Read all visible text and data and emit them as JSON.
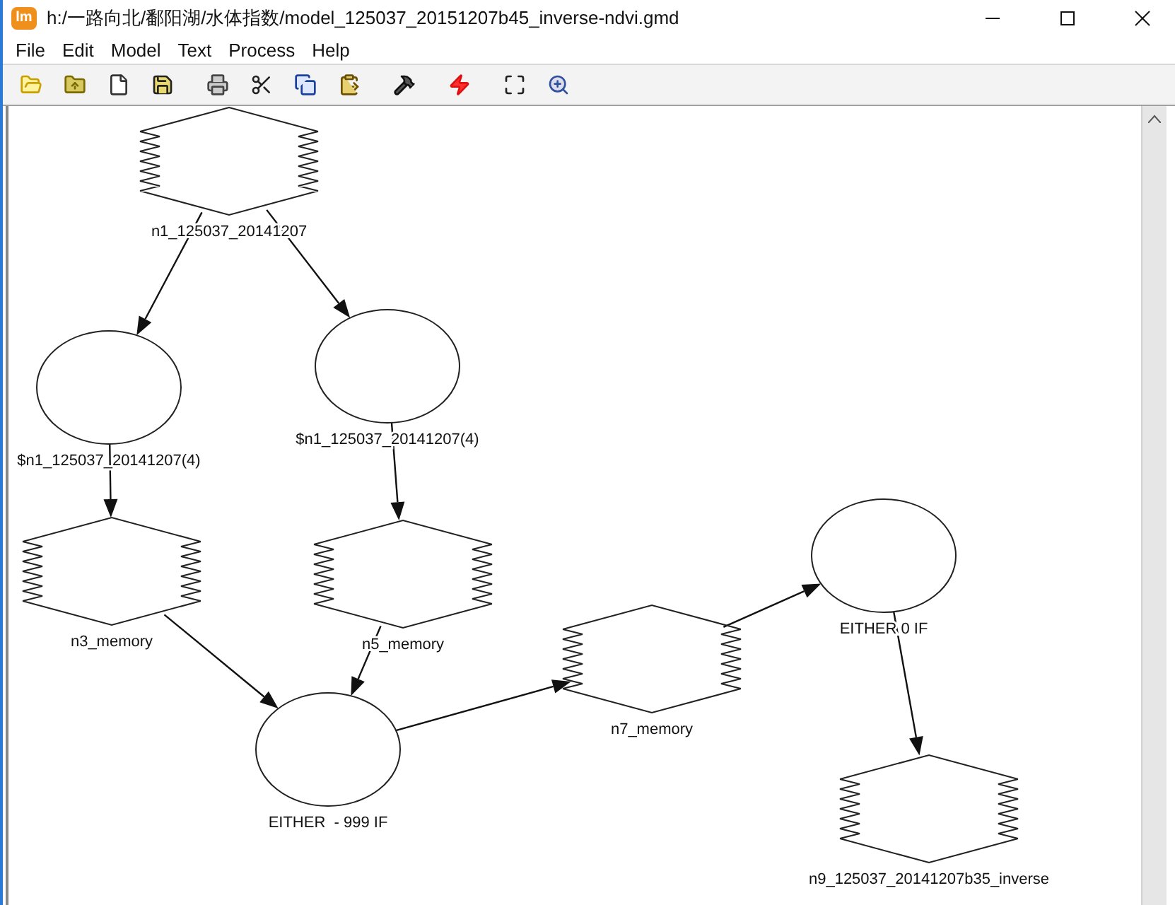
{
  "window": {
    "app_icon": "lm",
    "title": "h:/一路向北/鄱阳湖/水体指数/model_125037_20151207b45_inverse-ndvi.gmd"
  },
  "menu": [
    "File",
    "Edit",
    "Model",
    "Text",
    "Process",
    "Help"
  ],
  "toolbar": [
    {
      "kind": "open"
    },
    {
      "kind": "open-up"
    },
    {
      "kind": "new"
    },
    {
      "kind": "save"
    },
    {
      "kind": "print"
    },
    {
      "kind": "cut"
    },
    {
      "kind": "copy"
    },
    {
      "kind": "paste"
    },
    {
      "kind": "build"
    },
    {
      "kind": "run"
    },
    {
      "kind": "fit"
    },
    {
      "kind": "zoom"
    }
  ],
  "diagram": {
    "nodes": [
      {
        "kind": "raster",
        "label": "n1_125037_20141207"
      },
      {
        "kind": "function",
        "label": "$n1_125037_20141207(4)"
      },
      {
        "kind": "function",
        "label": "$n1_125037_20141207(4)"
      },
      {
        "kind": "raster",
        "label": "n3_memory"
      },
      {
        "kind": "raster",
        "label": "n5_memory"
      },
      {
        "kind": "function",
        "label": "EITHER  - 999 IF"
      },
      {
        "kind": "raster",
        "label": "n7_memory"
      },
      {
        "kind": "function",
        "label": "EITHER 0 IF"
      },
      {
        "kind": "raster",
        "label": "n9_125037_20141207b35_inverse"
      }
    ]
  }
}
